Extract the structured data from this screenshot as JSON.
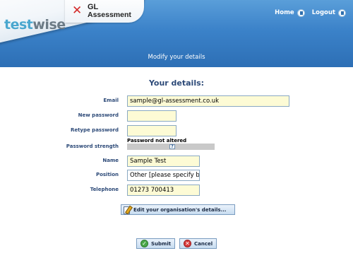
{
  "header": {
    "brand_gl_line1": "GL",
    "brand_gl_line2": "Assessment",
    "brand_testwise_part1": "test",
    "brand_testwise_part2": "wise",
    "nav": [
      {
        "label": "Home",
        "icon": "home-icon"
      },
      {
        "label": "Logout",
        "icon": "logout-icon"
      }
    ],
    "band_title": "Modify your details"
  },
  "form": {
    "title": "Your details:",
    "email": {
      "label": "Email",
      "value": "sample@gl-assessment.co.uk"
    },
    "new_password": {
      "label": "New password",
      "value": ""
    },
    "retype_password": {
      "label": "Retype password",
      "value": ""
    },
    "password_strength": {
      "label": "Password strength",
      "status": "Password not altered",
      "help_glyph": "?"
    },
    "name": {
      "label": "Name",
      "value": "Sample Test"
    },
    "position": {
      "label": "Position",
      "value": "Other [please specify b"
    },
    "telephone": {
      "label": "Telephone",
      "value": "01273 700413"
    }
  },
  "buttons": {
    "edit_org": "Edit your organisation's details...",
    "submit": "Submit",
    "cancel": "Cancel"
  },
  "colors": {
    "header_blue": "#3b82c9",
    "label_navy": "#2d4a78",
    "field_yellow": "#fdfbd5",
    "button_blue": "#c7dcf0"
  }
}
